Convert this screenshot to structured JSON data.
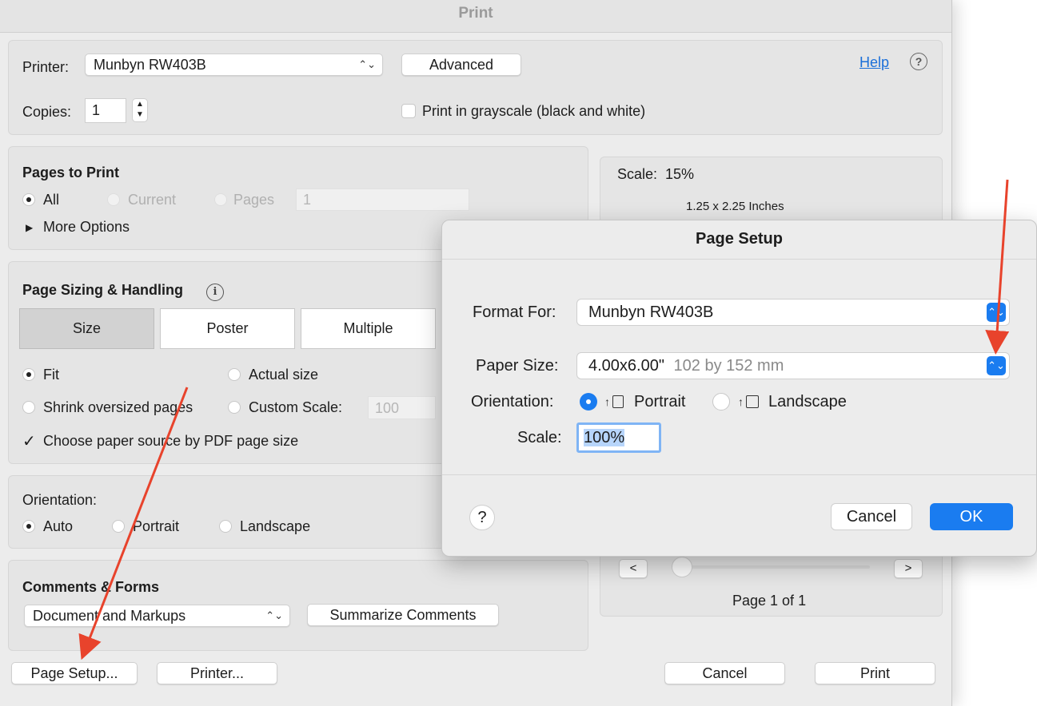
{
  "print_dialog": {
    "title": "Print",
    "printer_label": "Printer:",
    "printer_value": "Munbyn RW403B",
    "advanced_button": "Advanced",
    "help_link": "Help",
    "help_icon": "?",
    "copies_label": "Copies:",
    "copies_value": "1",
    "grayscale_label": "Print in grayscale (black and white)",
    "pages_to_print": {
      "heading": "Pages to Print",
      "all": "All",
      "current": "Current",
      "pages": "Pages",
      "pages_value": "1",
      "more_options": "More Options"
    },
    "page_sizing": {
      "heading": "Page Sizing & Handling",
      "info_icon": "i",
      "tabs": [
        "Size",
        "Poster",
        "Multiple"
      ],
      "fit": "Fit",
      "actual_size": "Actual size",
      "shrink": "Shrink oversized pages",
      "custom_scale": "Custom Scale:",
      "custom_scale_value": "100",
      "paper_source": "Choose paper source by PDF page size"
    },
    "orientation": {
      "heading": "Orientation:",
      "auto": "Auto",
      "portrait": "Portrait",
      "landscape": "Landscape"
    },
    "comments": {
      "heading": "Comments & Forms",
      "select_value": "Document and Markups",
      "summarize_button": "Summarize Comments"
    },
    "preview": {
      "scale_text": "Scale:  15%",
      "size_text": "1.25 x 2.25 Inches",
      "prev": "<",
      "next": ">",
      "page_text": "Page 1 of 1"
    },
    "buttons": {
      "page_setup": "Page Setup...",
      "printer": "Printer...",
      "cancel": "Cancel",
      "print": "Print"
    }
  },
  "page_setup": {
    "title": "Page Setup",
    "format_label": "Format For:",
    "format_value": "Munbyn RW403B",
    "paper_label": "Paper Size:",
    "paper_value": "4.00x6.00\"",
    "paper_detail": "102 by 152 mm",
    "orientation_label": "Orientation:",
    "portrait": "Portrait",
    "landscape": "Landscape",
    "scale_label": "Scale:",
    "scale_value": "100%",
    "help_icon": "?",
    "cancel": "Cancel",
    "ok": "OK"
  },
  "colors": {
    "accent": "#1a7cf0",
    "annotation_arrow": "#e8432c"
  }
}
